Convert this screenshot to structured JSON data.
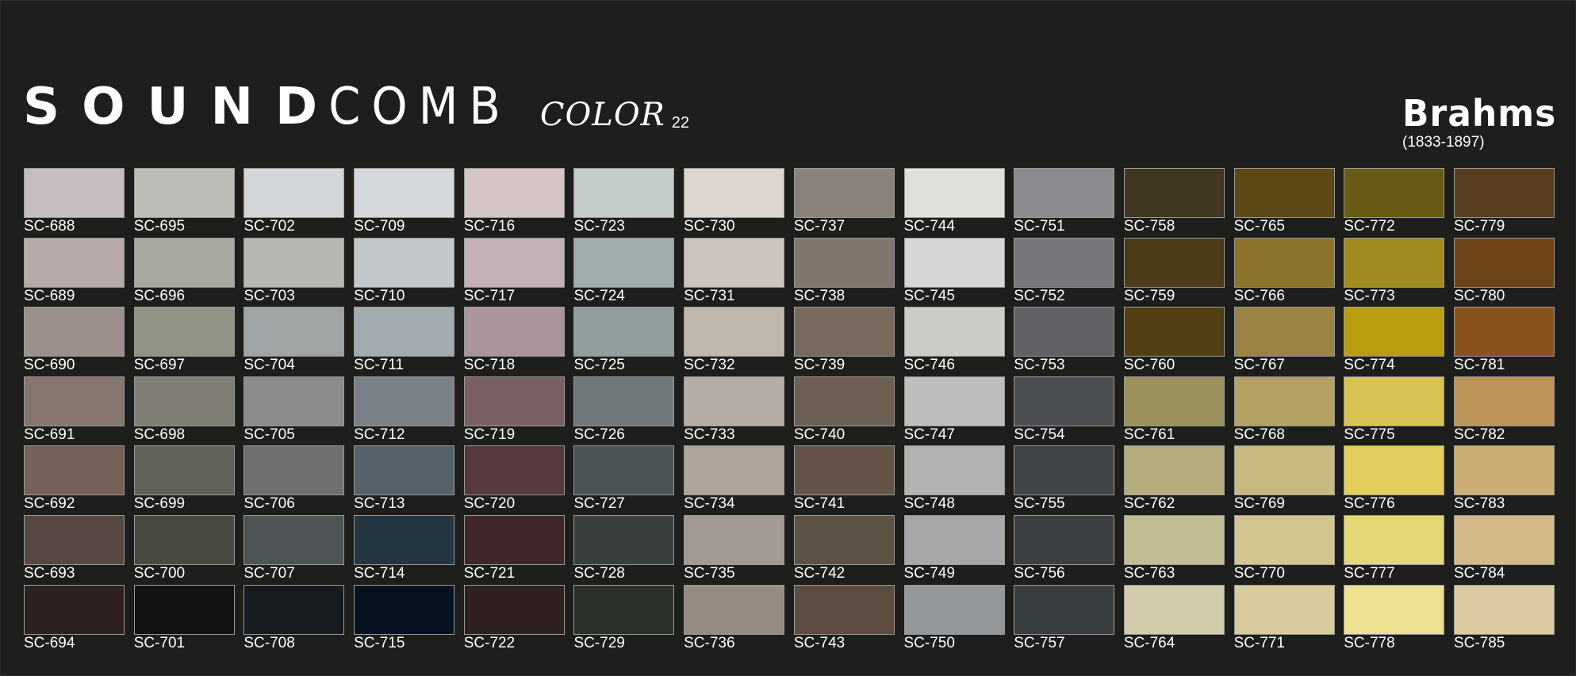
{
  "brand": {
    "name_bold": "SOUND",
    "name_light": "COMB",
    "collection": "COLOR",
    "collection_number": "22"
  },
  "composer": {
    "name": "Brahms",
    "years": "(1833-1897)"
  },
  "colors": {
    "background": "#1e1e1c",
    "swatch_border": "#9a9a96",
    "text": "#ffffff"
  },
  "swatches": [
    {
      "code": "SC-688",
      "hex": "#c6bebe"
    },
    {
      "code": "SC-695",
      "hex": "#bcbdb7"
    },
    {
      "code": "SC-702",
      "hex": "#d3d6d9"
    },
    {
      "code": "SC-709",
      "hex": "#d4d7db"
    },
    {
      "code": "SC-716",
      "hex": "#d4c4c6"
    },
    {
      "code": "SC-723",
      "hex": "#c3ccc9"
    },
    {
      "code": "SC-730",
      "hex": "#dcd5d0"
    },
    {
      "code": "SC-737",
      "hex": "#8a817a"
    },
    {
      "code": "SC-744",
      "hex": "#dfe0dc"
    },
    {
      "code": "SC-751",
      "hex": "#8a8b8e"
    },
    {
      "code": "SC-758",
      "hex": "#413720"
    },
    {
      "code": "SC-765",
      "hex": "#5e4815"
    },
    {
      "code": "SC-772",
      "hex": "#665a15"
    },
    {
      "code": "SC-779",
      "hex": "#583e1f"
    },
    {
      "code": "SC-689",
      "hex": "#b6aba8"
    },
    {
      "code": "SC-696",
      "hex": "#a7a8a0"
    },
    {
      "code": "SC-703",
      "hex": "#b6b7b2"
    },
    {
      "code": "SC-710",
      "hex": "#c2c7ca"
    },
    {
      "code": "SC-717",
      "hex": "#c3b1b5"
    },
    {
      "code": "SC-724",
      "hex": "#a2adad"
    },
    {
      "code": "SC-731",
      "hex": "#cdc4bf"
    },
    {
      "code": "SC-738",
      "hex": "#82776f"
    },
    {
      "code": "SC-745",
      "hex": "#d5d5d3"
    },
    {
      "code": "SC-752",
      "hex": "#76777a"
    },
    {
      "code": "SC-759",
      "hex": "#4b3b17"
    },
    {
      "code": "SC-766",
      "hex": "#8b7329"
    },
    {
      "code": "SC-773",
      "hex": "#a18b1e"
    },
    {
      "code": "SC-780",
      "hex": "#6f4418"
    },
    {
      "code": "SC-690",
      "hex": "#9c908d"
    },
    {
      "code": "SC-697",
      "hex": "#929385"
    },
    {
      "code": "SC-704",
      "hex": "#a1a4a5"
    },
    {
      "code": "SC-711",
      "hex": "#a2abaf"
    },
    {
      "code": "SC-718",
      "hex": "#aa959b"
    },
    {
      "code": "SC-725",
      "hex": "#919e9d"
    },
    {
      "code": "SC-732",
      "hex": "#c0b8ad"
    },
    {
      "code": "SC-739",
      "hex": "#776a5d"
    },
    {
      "code": "SC-746",
      "hex": "#cbccc8"
    },
    {
      "code": "SC-753",
      "hex": "#5f6164"
    },
    {
      "code": "SC-760",
      "hex": "#523f13"
    },
    {
      "code": "SC-767",
      "hex": "#9a8343"
    },
    {
      "code": "SC-774",
      "hex": "#b99e10"
    },
    {
      "code": "SC-781",
      "hex": "#8a531d"
    },
    {
      "code": "SC-691",
      "hex": "#87756f"
    },
    {
      "code": "SC-698",
      "hex": "#807e74"
    },
    {
      "code": "SC-705",
      "hex": "#8b8d8c"
    },
    {
      "code": "SC-712",
      "hex": "#7a8188"
    },
    {
      "code": "SC-719",
      "hex": "#7a6065"
    },
    {
      "code": "SC-726",
      "hex": "#6f797b"
    },
    {
      "code": "SC-733",
      "hex": "#b6aca6"
    },
    {
      "code": "SC-740",
      "hex": "#6e5f53"
    },
    {
      "code": "SC-747",
      "hex": "#bebfbd"
    },
    {
      "code": "SC-754",
      "hex": "#4c4f52"
    },
    {
      "code": "SC-761",
      "hex": "#9a915c"
    },
    {
      "code": "SC-768",
      "hex": "#b3a164"
    },
    {
      "code": "SC-775",
      "hex": "#d9c453"
    },
    {
      "code": "SC-782",
      "hex": "#bd9457"
    },
    {
      "code": "SC-692",
      "hex": "#756159"
    },
    {
      "code": "SC-699",
      "hex": "#63625a"
    },
    {
      "code": "SC-706",
      "hex": "#6e706e"
    },
    {
      "code": "SC-713",
      "hex": "#56626b"
    },
    {
      "code": "SC-720",
      "hex": "#55393d"
    },
    {
      "code": "SC-727",
      "hex": "#4a5356"
    },
    {
      "code": "SC-734",
      "hex": "#aea399"
    },
    {
      "code": "SC-741",
      "hex": "#645346"
    },
    {
      "code": "SC-748",
      "hex": "#b1b3b3"
    },
    {
      "code": "SC-755",
      "hex": "#404447"
    },
    {
      "code": "SC-762",
      "hex": "#b4ac7d"
    },
    {
      "code": "SC-769",
      "hex": "#c7b97f"
    },
    {
      "code": "SC-776",
      "hex": "#e3cd5c"
    },
    {
      "code": "SC-783",
      "hex": "#ccad74"
    },
    {
      "code": "SC-693",
      "hex": "#574844"
    },
    {
      "code": "SC-700",
      "hex": "#494b42"
    },
    {
      "code": "SC-707",
      "hex": "#4e5355"
    },
    {
      "code": "SC-714",
      "hex": "#243641"
    },
    {
      "code": "SC-721",
      "hex": "#40282a"
    },
    {
      "code": "SC-728",
      "hex": "#393f3e"
    },
    {
      "code": "SC-735",
      "hex": "#a39a95"
    },
    {
      "code": "SC-742",
      "hex": "#5e5244"
    },
    {
      "code": "SC-749",
      "hex": "#a6a7a8"
    },
    {
      "code": "SC-756",
      "hex": "#3d4042"
    },
    {
      "code": "SC-763",
      "hex": "#c3bd94"
    },
    {
      "code": "SC-770",
      "hex": "#d3c590"
    },
    {
      "code": "SC-777",
      "hex": "#e4d775"
    },
    {
      "code": "SC-784",
      "hex": "#d3b988"
    },
    {
      "code": "SC-694",
      "hex": "#2d2020"
    },
    {
      "code": "SC-701",
      "hex": "#111310"
    },
    {
      "code": "SC-708",
      "hex": "#151b1f"
    },
    {
      "code": "SC-715",
      "hex": "#061220"
    },
    {
      "code": "SC-722",
      "hex": "#30201f"
    },
    {
      "code": "SC-729",
      "hex": "#2c302b"
    },
    {
      "code": "SC-736",
      "hex": "#978b81"
    },
    {
      "code": "SC-743",
      "hex": "#5c4d40"
    },
    {
      "code": "SC-750",
      "hex": "#939799"
    },
    {
      "code": "SC-757",
      "hex": "#383d40"
    },
    {
      "code": "SC-764",
      "hex": "#d2ccab"
    },
    {
      "code": "SC-771",
      "hex": "#d8cb9c"
    },
    {
      "code": "SC-778",
      "hex": "#ece18f"
    },
    {
      "code": "SC-785",
      "hex": "#ddcba2"
    }
  ]
}
